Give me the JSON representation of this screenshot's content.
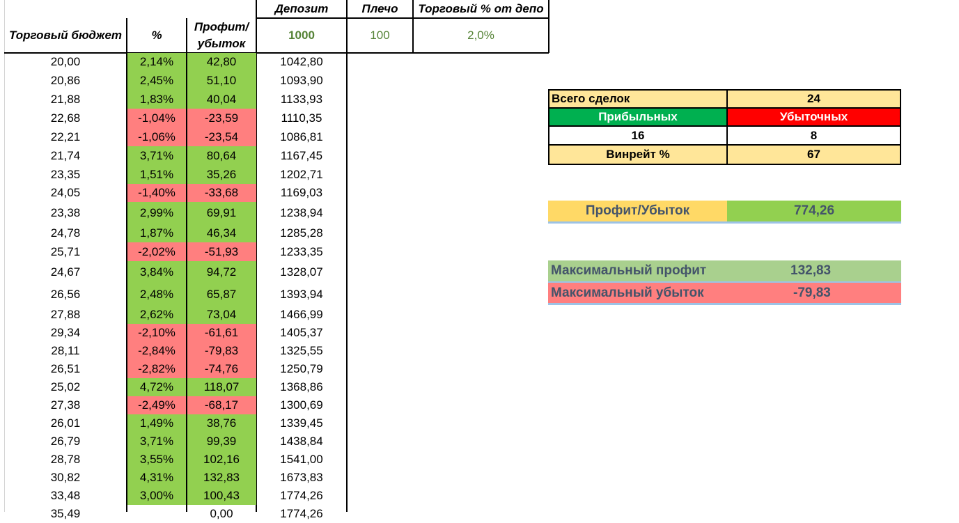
{
  "headers": {
    "budget": "Торговый бюджет",
    "percent": "%",
    "profit_line1": "Профит/",
    "profit_line2": "убыток",
    "deposit": "Депозит",
    "leverage": "Плечо",
    "trade_pct": "Торговый % от депо"
  },
  "params": {
    "deposit": "1000",
    "leverage": "100",
    "trade_pct": "2,0%"
  },
  "rows": [
    {
      "budget": "20,00",
      "pct": "2,14%",
      "pnl": "42,80",
      "dep": "1042,80",
      "win": true
    },
    {
      "budget": "20,86",
      "pct": "2,45%",
      "pnl": "51,10",
      "dep": "1093,90",
      "win": true
    },
    {
      "budget": "21,88",
      "pct": "1,83%",
      "pnl": "40,04",
      "dep": "1133,93",
      "win": true
    },
    {
      "budget": "22,68",
      "pct": "-1,04%",
      "pnl": "-23,59",
      "dep": "1110,35",
      "win": false
    },
    {
      "budget": "22,21",
      "pct": "-1,06%",
      "pnl": "-23,54",
      "dep": "1086,81",
      "win": false
    },
    {
      "budget": "21,74",
      "pct": "3,71%",
      "pnl": "80,64",
      "dep": "1167,45",
      "win": true
    },
    {
      "budget": "23,35",
      "pct": "1,51%",
      "pnl": "35,26",
      "dep": "1202,71",
      "win": true
    },
    {
      "budget": "24,05",
      "pct": "-1,40%",
      "pnl": "-33,68",
      "dep": "1169,03",
      "win": false
    },
    {
      "budget": "23,38",
      "pct": "2,99%",
      "pnl": "69,91",
      "dep": "1238,94",
      "win": true
    },
    {
      "budget": "24,78",
      "pct": "1,87%",
      "pnl": "46,34",
      "dep": "1285,28",
      "win": true
    },
    {
      "budget": "25,71",
      "pct": "-2,02%",
      "pnl": "-51,93",
      "dep": "1233,35",
      "win": false
    },
    {
      "budget": "24,67",
      "pct": "3,84%",
      "pnl": "94,72",
      "dep": "1328,07",
      "win": true
    },
    {
      "budget": "26,56",
      "pct": "2,48%",
      "pnl": "65,87",
      "dep": "1393,94",
      "win": true
    },
    {
      "budget": "27,88",
      "pct": "2,62%",
      "pnl": "73,04",
      "dep": "1466,99",
      "win": true
    },
    {
      "budget": "29,34",
      "pct": "-2,10%",
      "pnl": "-61,61",
      "dep": "1405,37",
      "win": false
    },
    {
      "budget": "28,11",
      "pct": "-2,84%",
      "pnl": "-79,83",
      "dep": "1325,55",
      "win": false
    },
    {
      "budget": "26,51",
      "pct": "-2,82%",
      "pnl": "-74,76",
      "dep": "1250,79",
      "win": false
    },
    {
      "budget": "25,02",
      "pct": "4,72%",
      "pnl": "118,07",
      "dep": "1368,86",
      "win": true
    },
    {
      "budget": "27,38",
      "pct": "-2,49%",
      "pnl": "-68,17",
      "dep": "1300,69",
      "win": false
    },
    {
      "budget": "26,01",
      "pct": "1,49%",
      "pnl": "38,76",
      "dep": "1339,45",
      "win": true
    },
    {
      "budget": "26,79",
      "pct": "3,71%",
      "pnl": "99,39",
      "dep": "1438,84",
      "win": true
    },
    {
      "budget": "28,78",
      "pct": "3,55%",
      "pnl": "102,16",
      "dep": "1541,00",
      "win": true
    },
    {
      "budget": "30,82",
      "pct": "4,31%",
      "pnl": "132,83",
      "dep": "1673,83",
      "win": true
    },
    {
      "budget": "33,48",
      "pct": "3,00%",
      "pnl": "100,43",
      "dep": "1774,26",
      "win": true
    },
    {
      "budget": "35,49",
      "pct": "",
      "pnl": "0,00",
      "dep": "1774,26",
      "win": null
    }
  ],
  "stats": {
    "total_label": "Всего сделок",
    "total_value": "24",
    "profitable_label": "Прибыльных",
    "losing_label": "Убыточных",
    "profitable_value": "16",
    "losing_value": "8",
    "winrate_label": "Винрейт %",
    "winrate_value": "67"
  },
  "summary": {
    "pnl_label": "Профит/Убыток",
    "pnl_value": "774,26",
    "max_profit_label": "Максимальный профит",
    "max_profit_value": "132,83",
    "max_loss_label": "Максимальный убыток",
    "max_loss_value": "-79,83"
  },
  "colors": {
    "win": "#92d050",
    "loss": "#ff7f7f",
    "tan": "#ffe699",
    "green_header": "#00b050",
    "red_header": "#ff0000",
    "param_text": "#548235"
  }
}
